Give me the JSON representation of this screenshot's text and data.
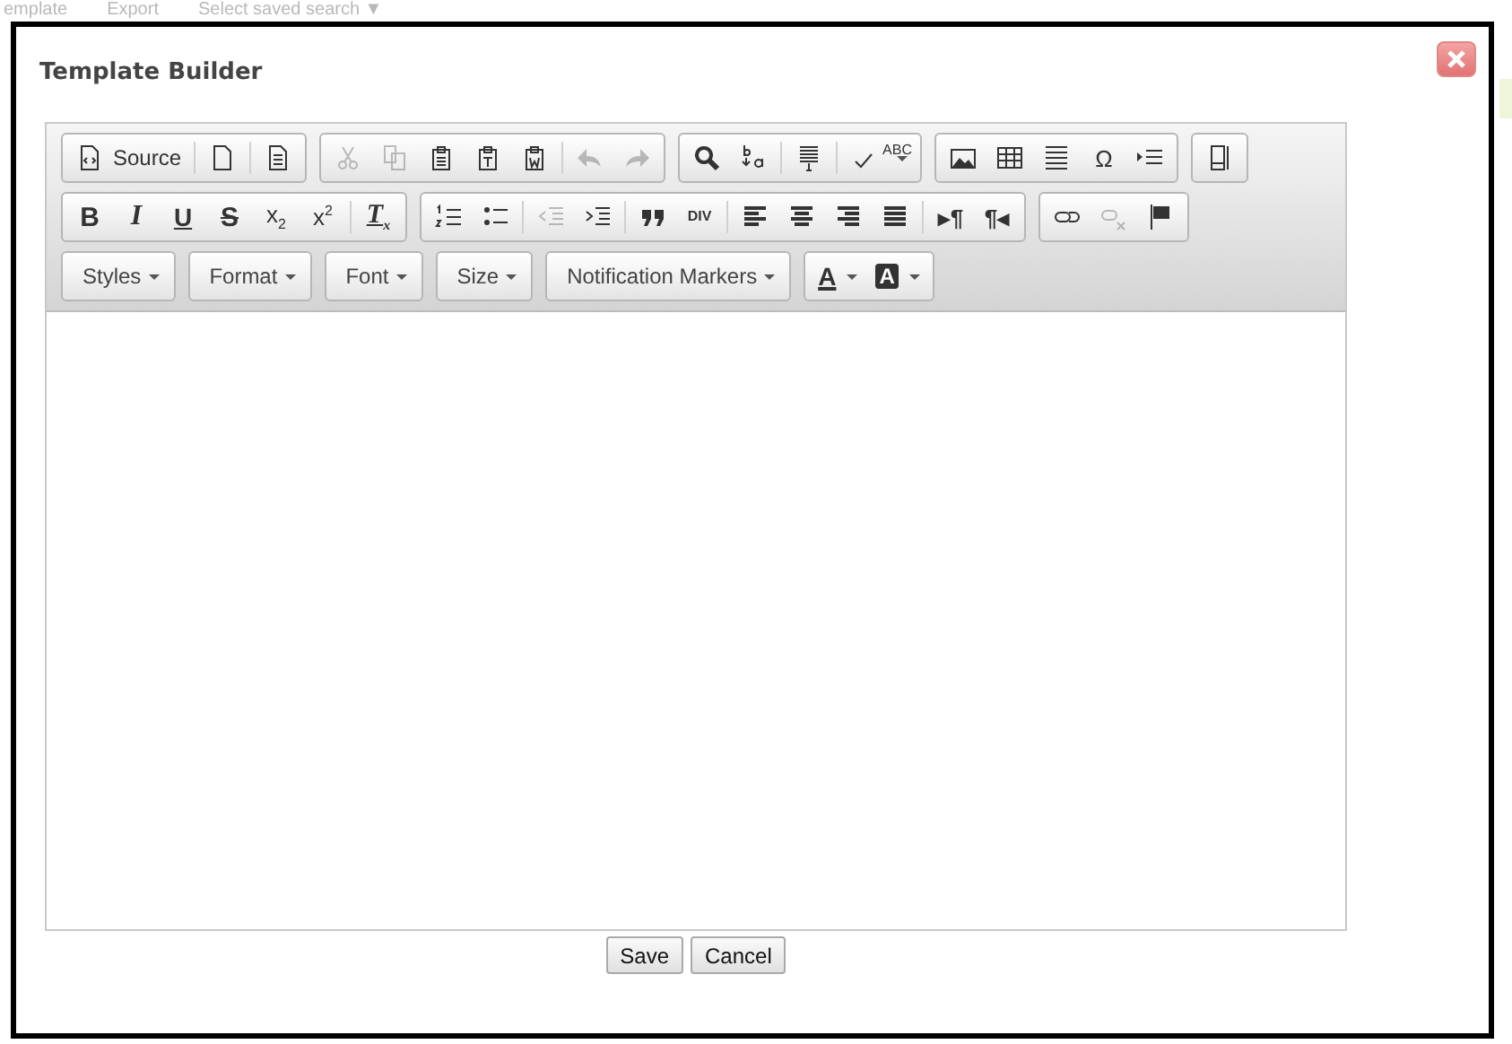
{
  "background": {
    "items": [
      "emplate",
      "Export",
      "Select saved search ▼"
    ]
  },
  "dialog": {
    "title": "Template Builder",
    "toolbar": {
      "rows": [
        {
          "groups": [
            {
              "sections": [
                [
                  {
                    "kind": "source",
                    "label": "Source",
                    "disabled": false
                  }
                ],
                [
                  {
                    "kind": "newpage",
                    "disabled": false
                  }
                ],
                [
                  {
                    "kind": "preview",
                    "disabled": false
                  }
                ]
              ]
            },
            {
              "sections": [
                [
                  {
                    "kind": "cut",
                    "disabled": true
                  },
                  {
                    "kind": "copy",
                    "disabled": true
                  },
                  {
                    "kind": "paste",
                    "disabled": false
                  },
                  {
                    "kind": "pastetext",
                    "disabled": false
                  },
                  {
                    "kind": "pasteword",
                    "disabled": false
                  }
                ],
                [
                  {
                    "kind": "undo",
                    "disabled": true
                  },
                  {
                    "kind": "redo",
                    "disabled": true
                  }
                ]
              ]
            },
            {
              "sections": [
                [
                  {
                    "kind": "find",
                    "disabled": false
                  },
                  {
                    "kind": "replace",
                    "disabled": false
                  }
                ],
                [
                  {
                    "kind": "selectall",
                    "disabled": false
                  }
                ],
                [
                  {
                    "kind": "spellcheck",
                    "glyph": "ABC",
                    "disabled": false
                  }
                ]
              ]
            },
            {
              "sections": [
                [
                  {
                    "kind": "image",
                    "disabled": false
                  },
                  {
                    "kind": "table",
                    "disabled": false
                  },
                  {
                    "kind": "hline",
                    "disabled": false
                  },
                  {
                    "kind": "glyph",
                    "glyph": "Ω",
                    "disabled": false
                  },
                  {
                    "kind": "indentblock",
                    "disabled": false
                  }
                ]
              ]
            },
            {
              "sections": [
                [
                  {
                    "kind": "maximize",
                    "disabled": false
                  }
                ]
              ]
            }
          ]
        },
        {
          "groups": [
            {
              "sections": [
                [
                  {
                    "kind": "bold",
                    "glyph": "B",
                    "disabled": false
                  },
                  {
                    "kind": "italic",
                    "glyph": "I",
                    "disabled": false
                  },
                  {
                    "kind": "underline",
                    "glyph": "U",
                    "disabled": false
                  },
                  {
                    "kind": "strike",
                    "glyph": "S",
                    "disabled": false
                  },
                  {
                    "kind": "glyph",
                    "glyph": "x$_{2}$",
                    "disabled": false
                  },
                  {
                    "kind": "glyph",
                    "glyph": "x$^{2}$",
                    "disabled": false
                  }
                ],
                [
                  {
                    "kind": "removeformat",
                    "glyph": "T$_{x}$",
                    "disabled": false
                  }
                ]
              ]
            },
            {
              "sections": [
                [
                  {
                    "kind": "numlist",
                    "disabled": false
                  },
                  {
                    "kind": "bullist",
                    "disabled": false
                  }
                ],
                [
                  {
                    "kind": "outdent",
                    "disabled": true
                  },
                  {
                    "kind": "indent",
                    "disabled": false
                  }
                ],
                [
                  {
                    "kind": "quote",
                    "disabled": false
                  },
                  {
                    "kind": "div",
                    "glyph": "DIV",
                    "disabled": false
                  }
                ],
                [
                  {
                    "kind": "alignleft",
                    "disabled": false
                  },
                  {
                    "kind": "aligncenter",
                    "disabled": false
                  },
                  {
                    "kind": "alignright",
                    "disabled": false
                  },
                  {
                    "kind": "justify",
                    "disabled": false
                  }
                ],
                [
                  {
                    "kind": "ltr",
                    "glyph": "▸¶",
                    "disabled": false
                  },
                  {
                    "kind": "rtl",
                    "glyph": "¶◂",
                    "disabled": false
                  }
                ]
              ]
            },
            {
              "sections": [
                [
                  {
                    "kind": "link",
                    "disabled": false
                  },
                  {
                    "kind": "unlink",
                    "disabled": true
                  },
                  {
                    "kind": "flag",
                    "disabled": false
                  }
                ]
              ]
            }
          ]
        },
        {
          "groups": [
            {
              "combo": "Styles"
            },
            {
              "combo": "Format"
            },
            {
              "combo": "Font"
            },
            {
              "combo": "Size"
            },
            {
              "combo": "Notification Markers"
            },
            {
              "sections": [
                [
                  {
                    "kind": "textcolor",
                    "glyph": "A",
                    "disabled": false
                  },
                  {
                    "kind": "bgcolor",
                    "glyph": "A",
                    "disabled": false
                  }
                ]
              ]
            }
          ]
        }
      ]
    },
    "buttons": [
      "Save",
      "Cancel"
    ]
  }
}
